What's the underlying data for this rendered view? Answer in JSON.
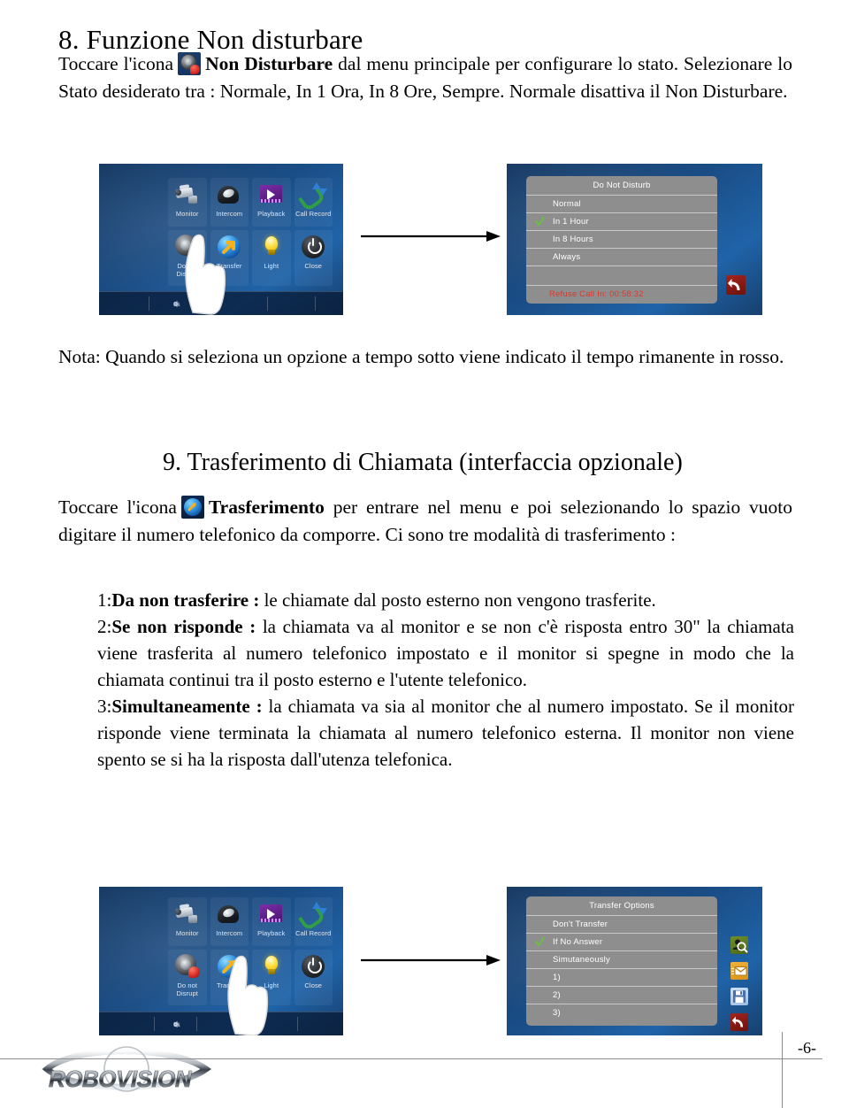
{
  "document": {
    "page_number": "-6-",
    "brand": "ROBOVISION"
  },
  "section8": {
    "heading": "8. Funzione Non disturbare",
    "para_before_icon": "Toccare l'icona",
    "para_bold": "Non Disturbare",
    "para_after_icon": "dal menu principale per configurare lo stato. Selezionare lo Stato desiderato tra : Normale, In 1 Ora, In 8 Ore, Sempre. Normale disattiva il Non Disturbare.",
    "icon_name": "do-not-disturb-icon",
    "note": "Nota: Quando si seleziona un opzione a tempo sotto viene indicato il tempo rimanente in rosso."
  },
  "section9": {
    "heading": "9. Trasferimento di Chiamata (interfaccia opzionale)",
    "para_before_icon": "Toccare l'icona",
    "para_bold": "Trasferimento",
    "para_after_icon": "per entrare nel menu e poi selezionando lo spazio vuoto digitare il numero telefonico da comporre. Ci sono tre modalità di trasferimento :",
    "icon_name": "transfer-icon",
    "items": [
      {
        "num": "1:",
        "bold": "Da non trasferire :",
        "rest": " le chiamate dal posto esterno non vengono trasferite."
      },
      {
        "num": "2:",
        "bold": "Se non risponde  :",
        "rest": " la chiamata va al monitor e se non c'è risposta entro 30\" la chiamata viene trasferita al numero telefonico impostato e il monitor si spegne in modo che la chiamata continui tra il posto esterno e l'utente telefonico."
      },
      {
        "num": "3:",
        "bold": "Simultaneamente  :",
        "rest": " la chiamata va sia al monitor che al numero impostato. Se il monitor risponde viene terminata la chiamata al numero telefonico esterna. Il monitor non viene spento se si ha la risposta dall'utenza telefonica."
      }
    ]
  },
  "figure_dnd": {
    "home_screen": {
      "tiles": [
        {
          "label": "Monitor",
          "icon": "camera-icon"
        },
        {
          "label": "Intercom",
          "icon": "phone-icon"
        },
        {
          "label": "Playback",
          "icon": "play-icon"
        },
        {
          "label": "Call Record",
          "icon": "call-record-icon"
        },
        {
          "label": "Do not Disrupt",
          "icon": "do-not-disturb-icon"
        },
        {
          "label": "Transfer",
          "icon": "transfer-icon"
        },
        {
          "label": "Light",
          "icon": "light-bulb-icon"
        },
        {
          "label": "Close",
          "icon": "power-icon"
        }
      ],
      "taskbar_icon": "gear-icon"
    },
    "menu": {
      "title": "Do Not Disturb",
      "rows": [
        {
          "label": "Normal",
          "checked": false
        },
        {
          "label": "In 1 Hour",
          "checked": true
        },
        {
          "label": "In 8 Hours",
          "checked": false
        },
        {
          "label": "Always",
          "checked": false
        }
      ],
      "blank_row": "",
      "timer": "Refuse  Call In:  00:58:32",
      "timer_color": "#d83a2e",
      "back_icon": "back-arrow-icon"
    }
  },
  "figure_transfer": {
    "home_screen": {
      "tiles": [
        {
          "label": "Monitor",
          "icon": "camera-icon"
        },
        {
          "label": "Intercom",
          "icon": "phone-icon"
        },
        {
          "label": "Playback",
          "icon": "play-icon"
        },
        {
          "label": "Call Record",
          "icon": "call-record-icon"
        },
        {
          "label": "Do not Disrupt",
          "icon": "do-not-disturb-icon"
        },
        {
          "label": "Transfer",
          "icon": "transfer-icon"
        },
        {
          "label": "Light",
          "icon": "light-bulb-icon"
        },
        {
          "label": "Close",
          "icon": "power-icon"
        }
      ],
      "taskbar_icon": "gear-icon"
    },
    "menu": {
      "title": "Transfer Options",
      "rows": [
        {
          "label": "Don't Transfer",
          "checked": false
        },
        {
          "label": "If No Answer",
          "checked": true
        },
        {
          "label": "Simutaneously",
          "checked": false
        },
        {
          "label": "1)",
          "checked": false
        },
        {
          "label": "2)",
          "checked": false
        },
        {
          "label": "3)",
          "checked": false
        }
      ],
      "side_icons": [
        {
          "name": "contact-search-icon",
          "color": "#5d7a22"
        },
        {
          "name": "mail-icon",
          "color": "#e8a52c"
        },
        {
          "name": "save-icon",
          "color": "#b6d0ee"
        },
        {
          "name": "back-arrow-icon",
          "color": "#8c1b15"
        }
      ]
    }
  }
}
